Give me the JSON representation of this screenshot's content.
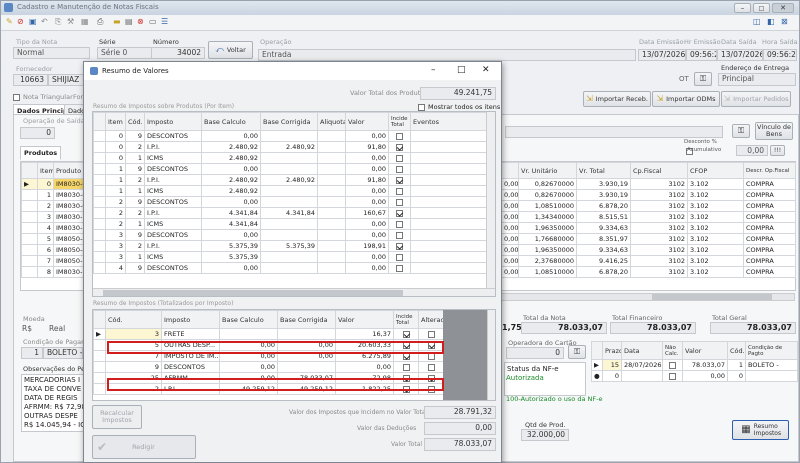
{
  "app": {
    "title": "Cadastro e Manutenção de Notas Fiscais"
  },
  "header": {
    "tipo_nota_label": "Tipo da Nota",
    "tipo_nota": "Normal",
    "serie_label": "Série",
    "serie": "Série 0",
    "numero_label": "Número",
    "numero": "34002",
    "voltar": "Voltar",
    "operacao_label": "Operação",
    "operacao": "Entrada",
    "data_emissao_label": "Data Emissão",
    "data_emissao": "13/07/2026",
    "hr_emissao_label": "Hr Emissão",
    "hr_emissao": "09:56:24",
    "data_saida_label": "Data Saída",
    "data_saida": "13/07/2026",
    "hora_saida_label": "Hora Saída",
    "hora_saida": "09:56:24",
    "fornecedor_label": "Fornecedor",
    "fornecedor_cod": "10663",
    "fornecedor_nome": "SHIJIAZ",
    "ot": "OT",
    "endereco_label": "Endereço de Entrega",
    "endereco": "Principal",
    "nota_triangular": "Nota Triangular",
    "for_label": "For"
  },
  "tabs": {
    "dados_principais": "Dados Principais",
    "dados": "Dado"
  },
  "main": {
    "operacao_saida_label": "Operação de Saída",
    "operacao_saida": "0",
    "produtos_tab": "Produtos",
    "importar_receb": "Importar Receb.",
    "importar_odms": "Importar ODMs",
    "importar_pedidos": "Importar Pedidos",
    "vinculo_bens": "Vínculo de Bens",
    "desconto_label": "Desconto %",
    "acumulativo": "Acumulativo",
    "desconto_val": "0,00",
    "prod_cols": [
      "Item",
      "Produto"
    ],
    "prod_rows": [
      {
        "item": "0",
        "produto": "IM8030-6"
      },
      {
        "item": "1",
        "produto": "IM8030-0"
      },
      {
        "item": "2",
        "produto": "IM8030-0"
      },
      {
        "item": "3",
        "produto": "IM8030-1"
      },
      {
        "item": "4",
        "produto": "IM8030-1"
      },
      {
        "item": "5",
        "produto": "IM8050-8"
      },
      {
        "item": "6",
        "produto": "IM8050-8"
      },
      {
        "item": "7",
        "produto": "IM8050-1"
      },
      {
        "item": "8",
        "produto": "IM8030-1"
      }
    ],
    "right_cols": [
      "Vr. Unitário",
      "Vr. Total",
      "Cp.Fiscal",
      "CFOP",
      "Descr. Op.Fiscal"
    ],
    "right_rows": [
      {
        "pre": "0,00",
        "unit": "0,82670000",
        "total": "3.930,19",
        "op": "3102",
        "cfop": "3.102",
        "desc": "COMPRA"
      },
      {
        "pre": "0,00",
        "unit": "0,82670000",
        "total": "3.930,19",
        "op": "3102",
        "cfop": "3.102",
        "desc": "COMPRA"
      },
      {
        "pre": "0,00",
        "unit": "1,08510000",
        "total": "6.878,20",
        "op": "3102",
        "cfop": "3.102",
        "desc": "COMPRA"
      },
      {
        "pre": "0,00",
        "unit": "1,34340000",
        "total": "8.515,51",
        "op": "3102",
        "cfop": "3.102",
        "desc": "COMPRA"
      },
      {
        "pre": "0,00",
        "unit": "1,96350000",
        "total": "9.334,63",
        "op": "3102",
        "cfop": "3.102",
        "desc": "COMPRA"
      },
      {
        "pre": "0,00",
        "unit": "1,76680000",
        "total": "8.351,97",
        "op": "3102",
        "cfop": "3.102",
        "desc": "COMPRA"
      },
      {
        "pre": "0,00",
        "unit": "1,96350000",
        "total": "9.334,63",
        "op": "3102",
        "cfop": "3.102",
        "desc": "COMPRA"
      },
      {
        "pre": "0,00",
        "unit": "2,37680000",
        "total": "9.416,25",
        "op": "3102",
        "cfop": "3.102",
        "desc": "COMPRA"
      },
      {
        "pre": "0,00",
        "unit": "1,08510000",
        "total": "6.878,20",
        "op": "3102",
        "cfop": "3.102",
        "desc": "COMPRA"
      }
    ],
    "moeda_label": "Moeda",
    "moeda_sym": "R$",
    "moeda": "Real",
    "condicao_label": "Condição de Pagamen",
    "condicao_cod": "1",
    "condicao": "BOLETO -",
    "obs_label": "Observações do Pedido",
    "obs_lines": [
      "MERCADORIAS I",
      "TAXA DE CONVE",
      "DATA DE REGIS",
      "AFRMM: R$ 72,98",
      "OUTRAS DESPE",
      "R$ 14.045,94 - ICM"
    ],
    "sum_left": "1,75",
    "total_nota_label": "Total da Nota",
    "total_nota": "78.033,07",
    "total_fin_label": "Total Financeiro",
    "total_fin": "78.033,07",
    "total_geral_label": "Total Geral",
    "total_geral": "78.033,07",
    "operadora_label": "Operadora do Cartão",
    "operadora": "0",
    "status_label": "Status da NF-e",
    "status": "Autorizada",
    "status_msg": "100-Autorizado o uso da NF-e",
    "parc_cols": [
      "Prazo",
      "Data",
      "Não Calc.",
      "Valor",
      "Cód.",
      "Condição de Pagto"
    ],
    "parc_rows": [
      {
        "prazo": "15",
        "data": "28/07/2026",
        "valor": "78.033,07",
        "cod": "1",
        "cond": "BOLETO -"
      },
      {
        "prazo": "0",
        "data": "",
        "valor": "0,00",
        "cod": "0",
        "cond": ""
      }
    ],
    "qtd_prod_label": "Qtd de Prod.",
    "qtd_prod": "32.000,00",
    "resumo_impostos": "Resumo Impostos"
  },
  "dialog": {
    "title": "Resumo de Valores",
    "valor_total_label": "Valor Total dos Produtos",
    "valor_total": "49.241,75",
    "resumo_prod_label": "Resumo de Impostos sobre Produtos (Por Item)",
    "mostrar_todos": "Mostrar todos os itens",
    "cols1": [
      "Item",
      "Cód.",
      "Imposto",
      "Base Calculo",
      "Base Corrigida",
      "Aliquota",
      "Valor",
      "Incide Total",
      "Eventos"
    ],
    "rows1": [
      {
        "item": "0",
        "cod": "9",
        "imp": "DESCONTOS",
        "bc": "0,00",
        "bcor": "",
        "aliq": "",
        "val": "0,00",
        "inc": false
      },
      {
        "item": "0",
        "cod": "2",
        "imp": "I.P.I.",
        "bc": "2.480,92",
        "bcor": "2.480,92",
        "aliq": "",
        "val": "91,80",
        "inc": true
      },
      {
        "item": "0",
        "cod": "1",
        "imp": "ICMS",
        "bc": "2.480,92",
        "bcor": "",
        "aliq": "",
        "val": "0,00",
        "inc": false
      },
      {
        "item": "1",
        "cod": "9",
        "imp": "DESCONTOS",
        "bc": "0,00",
        "bcor": "",
        "aliq": "",
        "val": "0,00",
        "inc": false
      },
      {
        "item": "1",
        "cod": "2",
        "imp": "I.P.I.",
        "bc": "2.480,92",
        "bcor": "2.480,92",
        "aliq": "",
        "val": "91,80",
        "inc": true
      },
      {
        "item": "1",
        "cod": "1",
        "imp": "ICMS",
        "bc": "2.480,92",
        "bcor": "",
        "aliq": "",
        "val": "0,00",
        "inc": false
      },
      {
        "item": "2",
        "cod": "9",
        "imp": "DESCONTOS",
        "bc": "0,00",
        "bcor": "",
        "aliq": "",
        "val": "0,00",
        "inc": false
      },
      {
        "item": "2",
        "cod": "2",
        "imp": "I.P.I.",
        "bc": "4.341,84",
        "bcor": "4.341,84",
        "aliq": "",
        "val": "160,67",
        "inc": true
      },
      {
        "item": "2",
        "cod": "1",
        "imp": "ICMS",
        "bc": "4.341,84",
        "bcor": "",
        "aliq": "",
        "val": "0,00",
        "inc": false
      },
      {
        "item": "3",
        "cod": "9",
        "imp": "DESCONTOS",
        "bc": "0,00",
        "bcor": "",
        "aliq": "",
        "val": "0,00",
        "inc": false
      },
      {
        "item": "3",
        "cod": "2",
        "imp": "I.P.I.",
        "bc": "5.375,39",
        "bcor": "5.375,39",
        "aliq": "",
        "val": "198,91",
        "inc": true
      },
      {
        "item": "3",
        "cod": "1",
        "imp": "ICMS",
        "bc": "5.375,39",
        "bcor": "",
        "aliq": "",
        "val": "0,00",
        "inc": false
      },
      {
        "item": "4",
        "cod": "9",
        "imp": "DESCONTOS",
        "bc": "0,00",
        "bcor": "",
        "aliq": "",
        "val": "0,00",
        "inc": false
      }
    ],
    "resumo_tot_label": "Resumo de Impostos (Totalizados por Imposto)",
    "cols2": [
      "Cód.",
      "Imposto",
      "Base Calculo",
      "Base Corrigida",
      "Valor",
      "Incide Total",
      "Alterado"
    ],
    "rows2": [
      {
        "cod": "3",
        "imp": "FRETE",
        "bc": "",
        "bcor": "",
        "val": "16,37",
        "inc": true,
        "alt": false
      },
      {
        "cod": "5",
        "imp": "OUTRAS DESP...",
        "bc": "0,00",
        "bcor": "0,00",
        "val": "20.603,33",
        "inc": true,
        "alt": true
      },
      {
        "cod": "7",
        "imp": "IMPOSTO DE IM...",
        "bc": "0,00",
        "bcor": "0,00",
        "val": "6.275,89",
        "inc": true,
        "alt": false
      },
      {
        "cod": "9",
        "imp": "DESCONTOS",
        "bc": "0,00",
        "bcor": "",
        "val": "0,00",
        "inc": false,
        "alt": false
      },
      {
        "cod": "25",
        "imp": "AFRMM",
        "bc": "0,00",
        "bcor": "78.033,07",
        "val": "72,98",
        "inc": true,
        "alt": true
      },
      {
        "cod": "2",
        "imp": "I.P.I.",
        "bc": "49.259,12",
        "bcor": "49.259,12",
        "val": "1.822,25",
        "inc": true,
        "alt": false
      }
    ],
    "recalcular": "Recalcular Impostos",
    "valor_impostos_label": "Valor dos Impostos que Incidem no Valor Total",
    "valor_impostos": "28.791,32",
    "valor_deducoes_label": "Valor das Deduções",
    "valor_deducoes": "0,00",
    "valor_total2_label": "Valor Total",
    "valor_total2": "78.033,07",
    "redigir": "Redigir"
  }
}
